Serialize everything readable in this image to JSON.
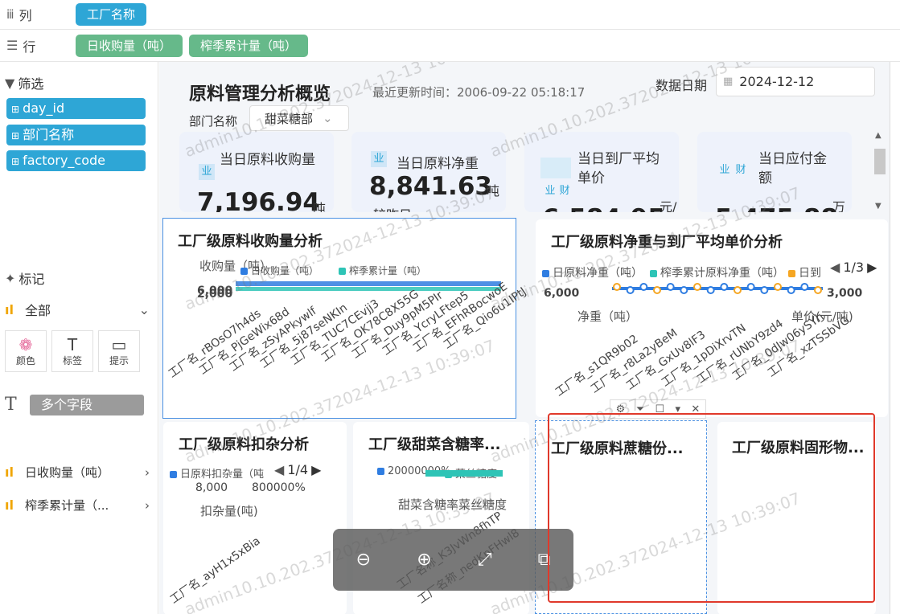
{
  "shelves": {
    "columns_label": "列",
    "columns_field": "工厂名称",
    "rows_label": "行",
    "rows_fields": [
      "日收购量（吨）",
      "榨季累计量（吨）"
    ]
  },
  "left": {
    "filter_title": "筛选",
    "filters": [
      "day_id",
      "部门名称",
      "factory_code"
    ],
    "marks_title": "标记",
    "marks_all": "全部",
    "mark_buttons": [
      "颜色",
      "标签",
      "提示"
    ],
    "multi_field": "多个字段",
    "measures": [
      "日收购量（吨）",
      "榨季累计量（..."
    ]
  },
  "dashboard": {
    "title": "原料管理分析概览",
    "update_label": "最近更新时间：2006-09-22 05:18:17",
    "date_label": "数据日期",
    "date_value": "2024-12-12",
    "dept_label": "部门名称",
    "dept_value": "甜菜糖部",
    "kpis": [
      {
        "badge": "业",
        "label": "当日原料收购量",
        "value": "7,196.94",
        "unit": "吨"
      },
      {
        "badge": "业",
        "label": "当日原料净重",
        "value": "8,841.63",
        "unit": "吨",
        "sub": "较昨日"
      },
      {
        "badge": "业",
        "badge2": "财",
        "label": "当日到厂平均单价",
        "value": "6,584.95",
        "unit": "元/"
      },
      {
        "badge": "业",
        "badge2": "财",
        "label": "当日应付金额",
        "value": "5,475.88",
        "unit": "万"
      }
    ],
    "charts": {
      "c1": {
        "title": "工厂级原料收购量分析",
        "ylabel": "收购量（吨）",
        "legend": [
          "日收购量（吨）",
          "榨季累计量（吨）"
        ],
        "yticks": [
          "6,000",
          "2,000"
        ],
        "x_labels": [
          "工厂名_rBOsO7h4ds",
          "工厂名_PjGeWix68d",
          "工厂名_zSyAPkywlf",
          "工厂名_5j87seNKIn",
          "工厂名_TUC7CEvjj3",
          "工厂名_OK78C8X55G",
          "工厂名_Duy9pM5PIr",
          "工厂名_YcryLFtep5",
          "工厂名_EFhRBocwoE",
          "工厂名_Qio6u1IPtJ"
        ]
      },
      "c2": {
        "title": "工厂级原料净重与到厂平均单价分析",
        "legend": [
          "日原料净重（吨）",
          "榨季累计原料净重（吨）",
          "日到"
        ],
        "pager": "1/3",
        "left_axis": "净重（吨）",
        "right_axis": "单价(元/吨)",
        "left_tick": "6,000",
        "right_tick": "3,000",
        "x_labels": [
          "工厂名_s1QR9b02",
          "工厂名_r8La2yBeM",
          "工厂名_GxUv8lF3",
          "工厂名_1pDiXrvTN",
          "工厂名_rUNbY9zd4",
          "工厂名_0dJw06ySYh",
          "工厂名_xzTSSbVG"
        ]
      },
      "c3": {
        "title": "工厂级原料扣杂分析",
        "legend": "日原料扣杂量（吨",
        "pager": "1/4",
        "ticks": [
          "8,000",
          "800000%"
        ],
        "ylabel": "扣杂量(吨)",
        "x_label": "工厂名_ayH1x5xBia"
      },
      "c4": {
        "title": "工厂级甜菜含糖率...",
        "legend": [
          "20000000%",
          "菜丝糖度"
        ],
        "ylabel": "甜菜含糖率菜丝糖度",
        "x_labels": [
          "工厂名称_K3JvWn8fhTP",
          "工厂名称_nedKpFHwl8"
        ]
      },
      "c5": {
        "title": "工厂级原料蔗糖份..."
      },
      "c6": {
        "title": "工厂级原料固形物..."
      }
    },
    "watermark": "admin10.10.202.372024-12-13 10:39:07"
  },
  "colors": {
    "shelf_blue": "#2ea6d6",
    "shelf_green": "#66b98a",
    "series_blue": "#2f7de1",
    "series_teal": "#2ec4b6",
    "series_orange": "#f5a623",
    "highlight_red": "#e0392b"
  },
  "icons": [
    "columns-icon",
    "rows-icon",
    "filter-icon",
    "mark-pin-icon",
    "bar-measure-icon",
    "color-icon",
    "text-label-icon",
    "tooltip-icon",
    "calendar-icon",
    "zoom-out-icon",
    "zoom-in-icon",
    "fullscreen-icon",
    "present-icon"
  ]
}
